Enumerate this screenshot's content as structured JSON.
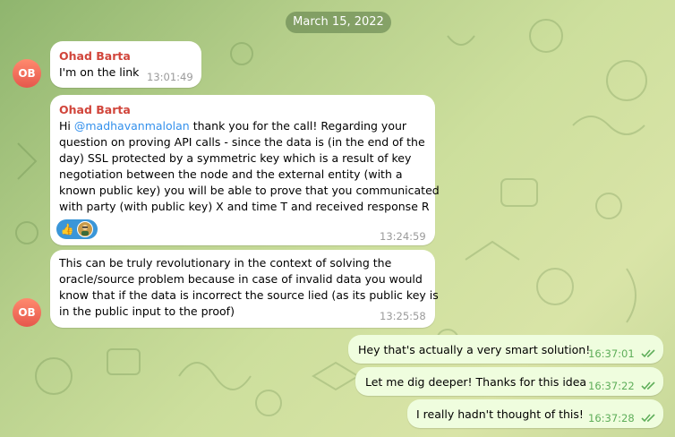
{
  "date_label": "March 15, 2022",
  "messages": [
    {
      "sender": "Ohad Barta",
      "text": "I'm on the link",
      "time": "13:01:49"
    },
    {
      "sender": "Ohad Barta",
      "text_before_mention": "Hi ",
      "mention": "@madhavanmalolan",
      "lines": [
        " thank you for the call! Regarding your",
        "question on proving API calls - since the data is (in the end of the",
        "day) SSL protected by a symmetric key which is a result of key",
        "negotiation between the node and the external entity (with a",
        "known public key) you will be able to prove that you communicated",
        "with party (with public key) X and time T and received response R"
      ],
      "reaction_emoji": "👍",
      "time": "13:24:59"
    },
    {
      "lines": [
        "This can be truly revolutionary in the context of solving the",
        "oracle/source problem because in case of invalid data you would",
        "know that if the data is incorrect the source lied (as its public key is",
        "in the public input to the proof)"
      ],
      "time": "13:25:58"
    },
    {
      "text": "Hey that's actually a very smart solution!",
      "time": "16:37:01"
    },
    {
      "text": "Let me dig deeper! Thanks for this idea",
      "time": "16:37:22"
    },
    {
      "text": "I really hadn't thought of this!",
      "time": "16:37:28"
    }
  ],
  "avatar_initials": "OB",
  "colors": {
    "sender_name": "#d1453b",
    "mention": "#3390ec",
    "outgoing_bubble": "#effdde",
    "read_checks": "#5fae5a",
    "reaction_bg": "#3a96d8"
  },
  "icons": {
    "read_status": "double-check-icon",
    "reaction_avatar": "user-avatar-icon"
  }
}
